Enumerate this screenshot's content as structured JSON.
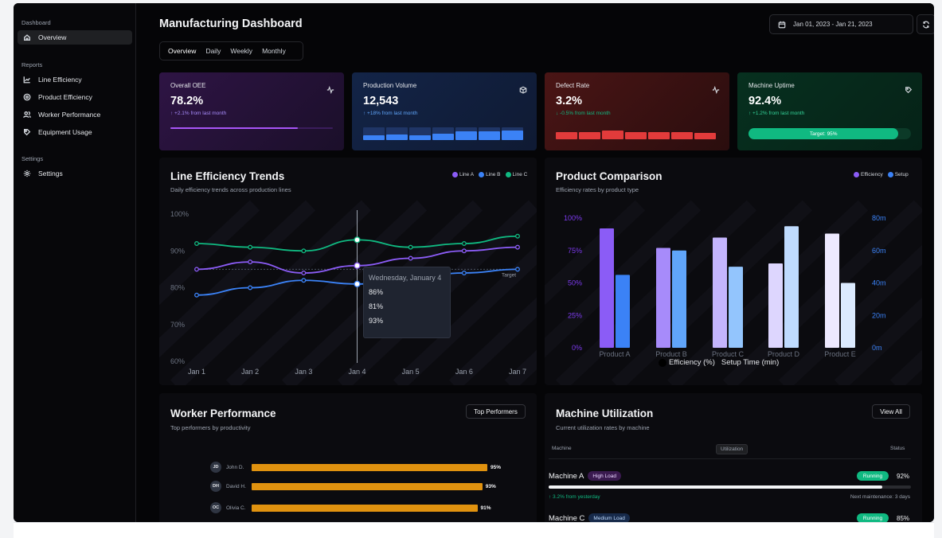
{
  "sidebar": {
    "sections": [
      {
        "title": "Dashboard",
        "items": [
          {
            "label": "Overview",
            "icon": "home-icon",
            "active": true
          }
        ]
      },
      {
        "title": "Reports",
        "items": [
          {
            "label": "Line Efficiency",
            "icon": "line-chart-icon"
          },
          {
            "label": "Product Efficiency",
            "icon": "package-icon"
          },
          {
            "label": "Worker Performance",
            "icon": "users-icon"
          },
          {
            "label": "Equipment Usage",
            "icon": "wrench-icon"
          }
        ]
      },
      {
        "title": "Settings",
        "items": [
          {
            "label": "Settings",
            "icon": "gear-icon"
          }
        ]
      }
    ]
  },
  "header": {
    "title": "Manufacturing Dashboard",
    "tabs": [
      "Overview",
      "Daily",
      "Weekly",
      "Monthly"
    ],
    "active_tab": "Overview",
    "date_range": "Jan 01, 2023 - Jan 21, 2023"
  },
  "kpis": [
    {
      "label": "Overall OEE",
      "value": "78.2%",
      "change": "↑ +2.1% from last month",
      "icon": "activity-icon",
      "progress": 0.78,
      "change_color": "#a78bfa"
    },
    {
      "label": "Production Volume",
      "value": "12,543",
      "change": "↑ +18% from last month",
      "icon": "box-icon",
      "change_color": "#60a5fa"
    },
    {
      "label": "Defect Rate",
      "value": "3.2%",
      "change": "↓ -0.5% from last month",
      "icon": "activity-icon",
      "change_color": "#10b981"
    },
    {
      "label": "Machine Uptime",
      "value": "92.4%",
      "change": "↑ +1.2% from last month",
      "icon": "tag-icon",
      "progress": 0.924,
      "target_label": "Target: 95%",
      "change_color": "#34d399"
    }
  ],
  "line_efficiency": {
    "title": "Line Efficiency Trends",
    "subtitle": "Daily efficiency trends across production lines",
    "target_label": "Target",
    "tooltip": {
      "date": "Wednesday, January 4",
      "values": [
        "86%",
        "81%",
        "93%"
      ]
    },
    "chart_data": {
      "type": "line",
      "x": [
        "Jan 1",
        "Jan 2",
        "Jan 3",
        "Jan 4",
        "Jan 5",
        "Jan 6",
        "Jan 7"
      ],
      "y_ticks": [
        "100%",
        "90%",
        "80%",
        "70%",
        "60%"
      ],
      "ylim": [
        60,
        100
      ],
      "target": 85,
      "series": [
        {
          "name": "Line A",
          "color": "#8b5cf6",
          "values": [
            85,
            87,
            84,
            86,
            88,
            90,
            91
          ]
        },
        {
          "name": "Line B",
          "color": "#3b82f6",
          "values": [
            78,
            80,
            82,
            81,
            83,
            84,
            85
          ]
        },
        {
          "name": "Line C",
          "color": "#10b981",
          "values": [
            92,
            91,
            90,
            93,
            91,
            92,
            94
          ]
        }
      ]
    }
  },
  "product_comparison": {
    "title": "Product Comparison",
    "subtitle": "Efficiency rates by product type",
    "legend_bottom": [
      "Efficiency (%)",
      "Setup Time (min)"
    ],
    "chart_data": {
      "type": "bar",
      "categories": [
        "Product A",
        "Product B",
        "Product C",
        "Product D",
        "Product E"
      ],
      "left_ticks": [
        "100%",
        "75%",
        "50%",
        "25%",
        "0%"
      ],
      "right_ticks": [
        "80m",
        "60m",
        "40m",
        "20m",
        "0m"
      ],
      "ylim_left": [
        0,
        100
      ],
      "ylim_right": [
        0,
        80
      ],
      "series": [
        {
          "name": "Efficiency",
          "axis": "left",
          "values": [
            92,
            77,
            85,
            65,
            88
          ],
          "colors": [
            "#8b5cf6",
            "#a78bfa",
            "#c4b5fd",
            "#ddd6fe",
            "#ede9fe"
          ]
        },
        {
          "name": "Setup",
          "axis": "right",
          "values": [
            45,
            60,
            50,
            75,
            40
          ],
          "colors": [
            "#3b82f6",
            "#60a5fa",
            "#93c5fd",
            "#bfdbfe",
            "#dbeafe"
          ]
        }
      ]
    }
  },
  "worker_performance": {
    "title": "Worker Performance",
    "subtitle": "Top performers by productivity",
    "button": "Top Performers",
    "workers": [
      {
        "initials": "JD",
        "name": "John D.",
        "value": 95,
        "label": "95%"
      },
      {
        "initials": "DH",
        "name": "David H.",
        "value": 93,
        "label": "93%"
      },
      {
        "initials": "OC",
        "name": "Olivia C.",
        "value": 91,
        "label": "91%"
      }
    ]
  },
  "machine_utilization": {
    "title": "Machine Utilization",
    "subtitle": "Current utilization rates by machine",
    "button": "View All",
    "columns": [
      "Machine",
      "Utilization",
      "Status"
    ],
    "machines": [
      {
        "name": "Machine A",
        "load": "High Load",
        "status": "Running",
        "value": 92,
        "pct": "92%",
        "change": "↑ 3.2% from yesterday",
        "maintenance": "Next maintenance: 3 days"
      },
      {
        "name": "Machine C",
        "load": "Medium Load",
        "status": "Running",
        "value": 85,
        "pct": "85%"
      }
    ]
  }
}
